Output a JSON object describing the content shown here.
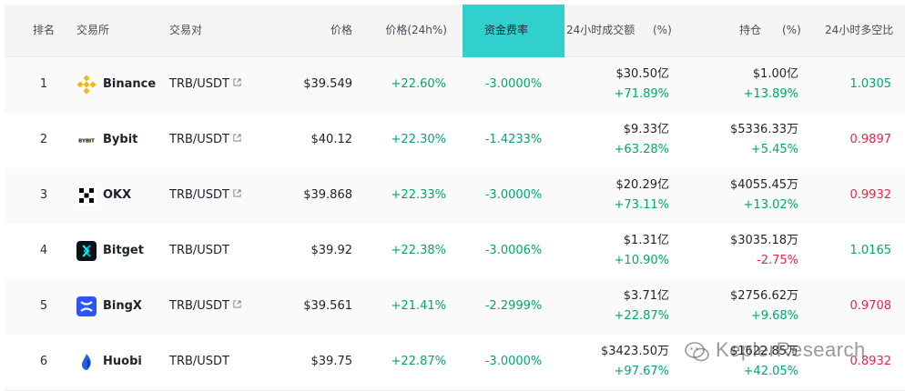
{
  "headers": {
    "rank": "排名",
    "exchange": "交易所",
    "pair": "交易对",
    "price": "价格",
    "price_change": "价格(24h%)",
    "funding_rate": "资金费率",
    "volume": "24小时成交额",
    "volume_pct": "(%)",
    "open_interest": "持仓",
    "oi_pct": "(%)",
    "long_short": "24小时多空比"
  },
  "rows": [
    {
      "rank": "1",
      "exchange": "Binance",
      "pair": "TRB/USDT",
      "has_link": true,
      "price": "$39.549",
      "change": "+22.60%",
      "funding": "-3.0000%",
      "volume": "$30.50亿",
      "volume_change": "+71.89%",
      "oi": "$1.00亿",
      "oi_change": "+13.89%",
      "ls_ratio": "1.0305",
      "ls_color": "green",
      "oi_color": "green"
    },
    {
      "rank": "2",
      "exchange": "Bybit",
      "pair": "TRB/USDT",
      "has_link": true,
      "price": "$40.12",
      "change": "+22.30%",
      "funding": "-1.4233%",
      "volume": "$9.33亿",
      "volume_change": "+63.28%",
      "oi": "$5336.33万",
      "oi_change": "+5.45%",
      "ls_ratio": "0.9897",
      "ls_color": "red",
      "oi_color": "green"
    },
    {
      "rank": "3",
      "exchange": "OKX",
      "pair": "TRB/USDT",
      "has_link": true,
      "price": "$39.868",
      "change": "+22.33%",
      "funding": "-3.0000%",
      "volume": "$20.29亿",
      "volume_change": "+73.11%",
      "oi": "$4055.45万",
      "oi_change": "+13.02%",
      "ls_ratio": "0.9932",
      "ls_color": "red",
      "oi_color": "green"
    },
    {
      "rank": "4",
      "exchange": "Bitget",
      "pair": "TRB/USDT",
      "has_link": false,
      "price": "$39.92",
      "change": "+22.38%",
      "funding": "-3.0006%",
      "volume": "$1.31亿",
      "volume_change": "+10.90%",
      "oi": "$3035.18万",
      "oi_change": "-2.75%",
      "ls_ratio": "1.0165",
      "ls_color": "green",
      "oi_color": "red"
    },
    {
      "rank": "5",
      "exchange": "BingX",
      "pair": "TRB/USDT",
      "has_link": true,
      "price": "$39.561",
      "change": "+21.41%",
      "funding": "-2.2999%",
      "volume": "$3.71亿",
      "volume_change": "+22.87%",
      "oi": "$2756.62万",
      "oi_change": "+9.68%",
      "ls_ratio": "0.9708",
      "ls_color": "red",
      "oi_color": "green"
    },
    {
      "rank": "6",
      "exchange": "Huobi",
      "pair": "TRB/USDT",
      "has_link": false,
      "price": "$39.75",
      "change": "+22.87%",
      "funding": "-3.0000%",
      "volume": "$3423.50万",
      "volume_change": "+97.67%",
      "oi": "$1622.85万",
      "oi_change": "+42.05%",
      "ls_ratio": "0.8932",
      "ls_color": "red",
      "oi_color": "green"
    }
  ],
  "watermark": "KeplerResearch",
  "colors": {
    "highlight": "#31d0cf",
    "green": "#03a66d",
    "red": "#e0294a"
  }
}
